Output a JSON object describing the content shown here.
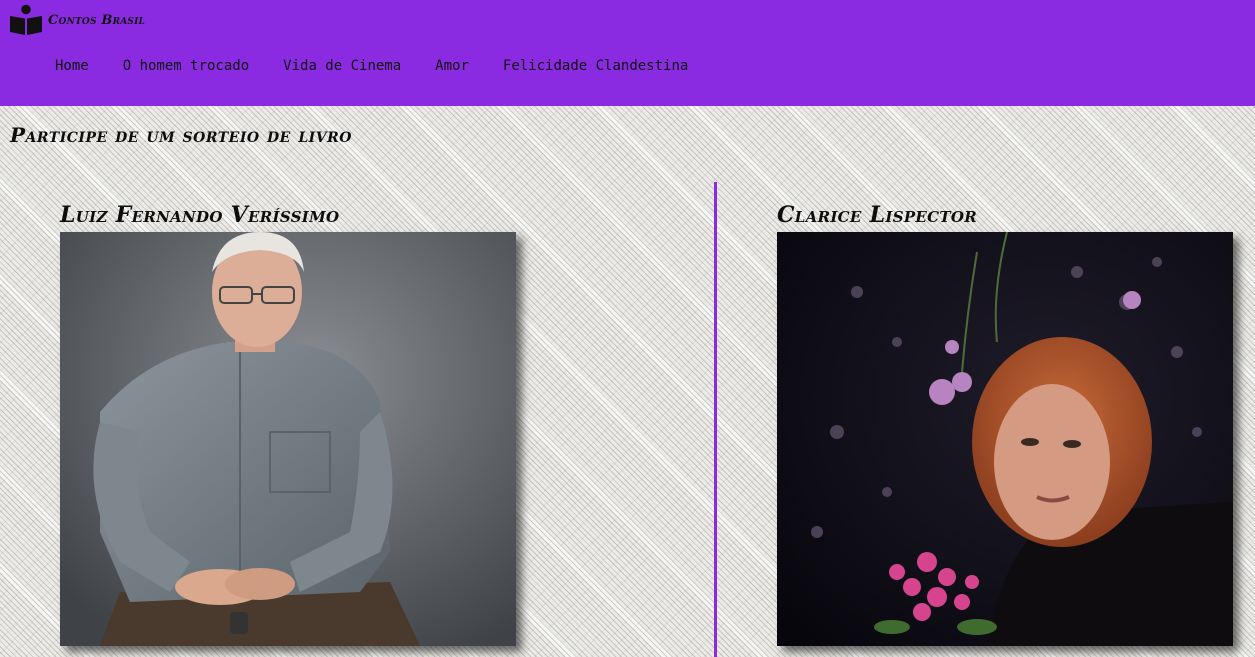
{
  "header": {
    "logo_text": "Contos Brasil",
    "logo_icon": "reader-book-icon",
    "nav": [
      {
        "label": "Home"
      },
      {
        "label": "O homem trocado"
      },
      {
        "label": "Vida de Cinema"
      },
      {
        "label": "Amor"
      },
      {
        "label": "Felicidade Clandestina"
      }
    ]
  },
  "main": {
    "promo_title": "Participe de um sorteio de livro",
    "authors": [
      {
        "name": "Luiz Fernando Veríssimo"
      },
      {
        "name": "Clarice Lispector"
      }
    ]
  },
  "colors": {
    "accent": "#8a2be2",
    "text": "#111111"
  }
}
